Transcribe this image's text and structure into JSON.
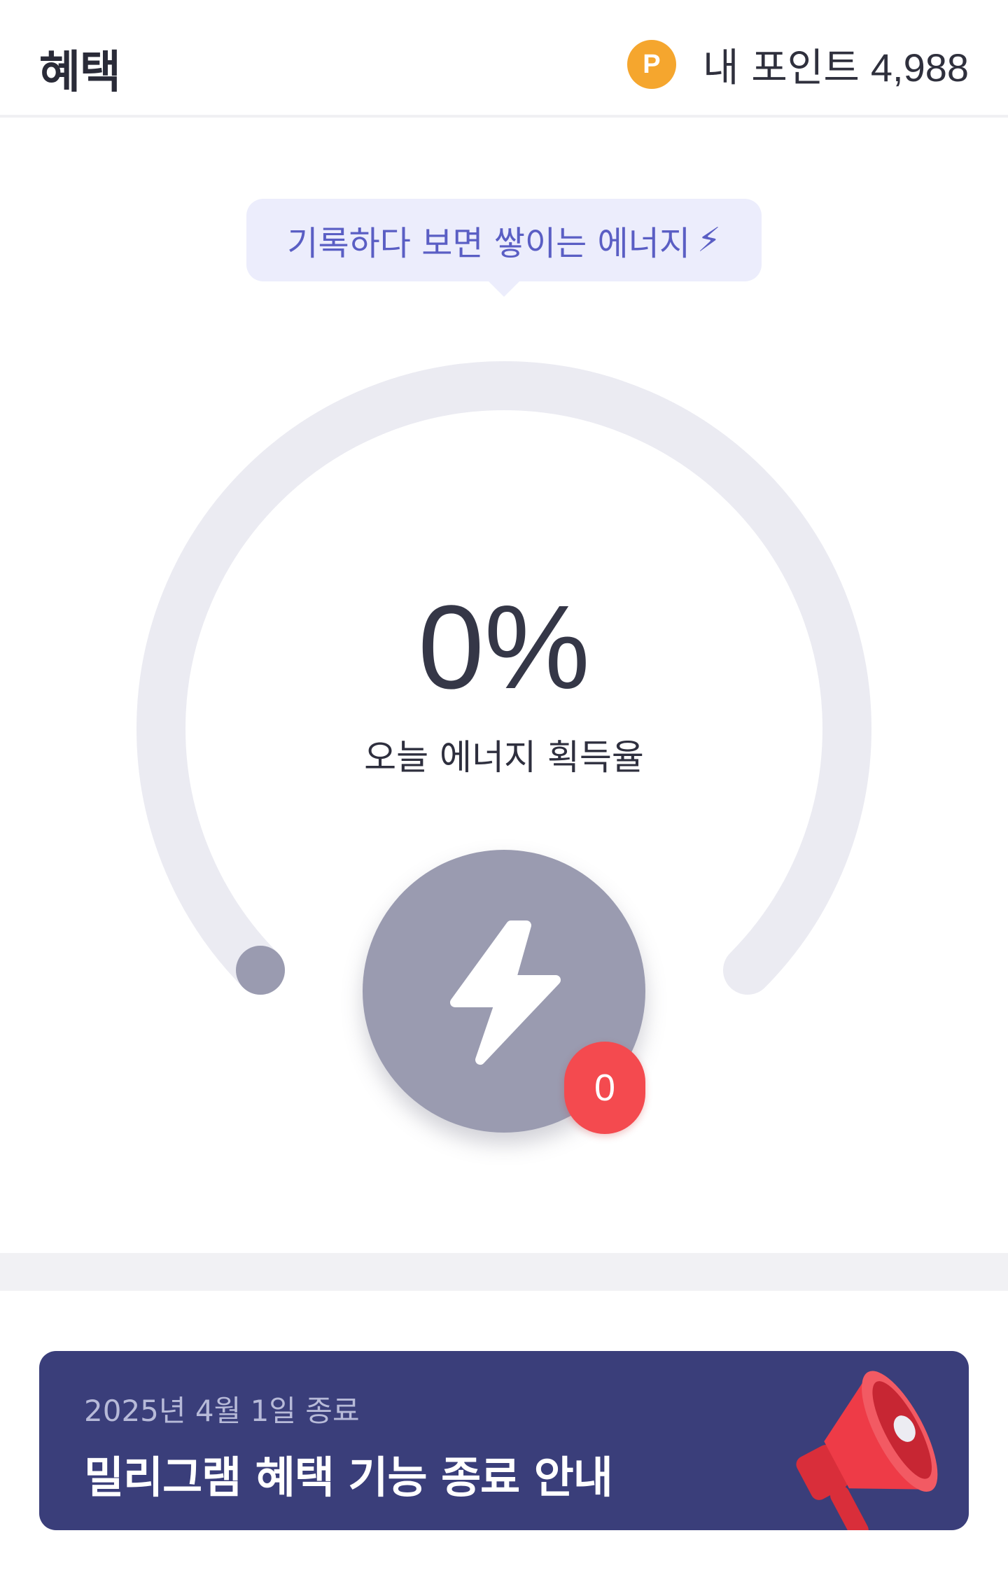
{
  "header": {
    "title": "혜택",
    "points_icon": "P",
    "points_label": "내 포인트",
    "points_value": "4,988"
  },
  "tooltip": {
    "text": "기록하다 보면 쌓이는 에너지",
    "emoji": "⚡"
  },
  "gauge": {
    "percent_text": "0%",
    "progress": 0,
    "label": "오늘 에너지 획득율"
  },
  "energy": {
    "icon": "lightning-bolt-icon",
    "count": "0"
  },
  "banner": {
    "date": "2025년 4월 1일 종료",
    "title": "밀리그램 혜택 기능 종료 안내",
    "icon": "megaphone-icon"
  },
  "colors": {
    "accent": "#5a5ec4",
    "coin": "#f5a62e",
    "gauge_track": "#ebebf2",
    "energy_button": "#9a9bb0",
    "badge": "#f44a4f",
    "banner_bg": "#3a3e7a"
  }
}
